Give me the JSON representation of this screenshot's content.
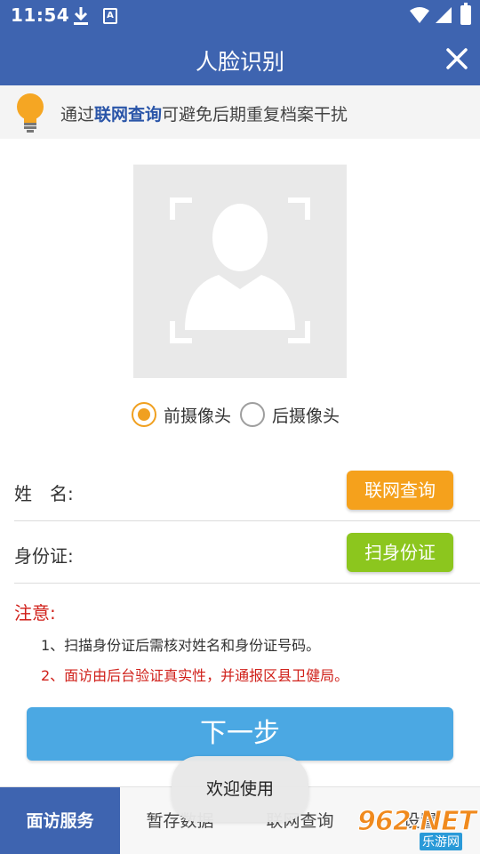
{
  "status": {
    "time": "11:54",
    "notification_letter": "A"
  },
  "appbar": {
    "title": "人脸识别"
  },
  "tip": {
    "prefix": "通过",
    "link": "联网查询",
    "suffix": "可避免后期重复档案干扰"
  },
  "camera": {
    "options": [
      "前摄像头",
      "后摄像头"
    ],
    "selected": "前摄像头"
  },
  "form": {
    "name_label": "姓　名:",
    "name_button": "联网查询",
    "id_label": "身份证:",
    "id_button": "扫身份证"
  },
  "notes": {
    "heading": "注意:",
    "items": [
      "1、扫描身份证后需核对姓名和身份证号码。",
      "2、面访由后台验证真实性，并通报区县卫健局。"
    ]
  },
  "next_button": "下一步",
  "toast": "欢迎使用",
  "bottom_nav": [
    "面访服务",
    "暂存数据",
    "联网查询",
    "设置"
  ],
  "watermark": {
    "logo": "962.NET",
    "sub": "乐游网"
  },
  "colors": {
    "primary": "#3e64b0",
    "orange": "#f5a11c",
    "green": "#8cc61e",
    "next": "#4ba8e3",
    "warning": "#d0201a"
  }
}
